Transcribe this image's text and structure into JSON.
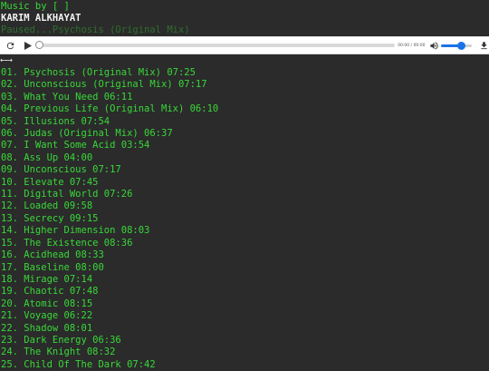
{
  "header": {
    "music_by": "Music by [ ]",
    "artist": "KARIM ALKHAYAT",
    "status": "Paused...Psychosis (Original Mix)"
  },
  "player": {
    "current_time": "00:00",
    "duration": "00:00",
    "time_separator": "/",
    "volume_level": 0.64,
    "progress": 0,
    "icons": [
      "reload-icon",
      "play-icon",
      "volume-icon",
      "download-icon"
    ]
  },
  "arrows": "⟵⟶",
  "tracks": [
    "01. Psychosis (Original Mix) 07:25",
    "02. Unconscious (Original Mix) 07:17",
    "03. What You Need 06:11",
    "04. Previous Life (Original Mix) 06:10",
    "05. Illusions 07:54",
    "06. Judas (Original Mix) 06:37",
    "07. I Want Some Acid 03:54",
    "08. Ass Up 04:00",
    "09. Unconscious 07:17",
    "10. Elevate 07:45",
    "11. Digital World 07:26",
    "12. Loaded 09:58",
    "13. Secrecy 09:15",
    "14. Higher Dimension 08:03",
    "15. The Existence 08:36",
    "16. Acidhead 08:33",
    "17. Baseline 08:00",
    "18. Mirage 07:14",
    "19. Chaotic 07:48",
    "20. Atomic 08:15",
    "21. Voyage 06:22",
    "22. Shadow 08:01",
    "23. Dark Energy 06:36",
    "24. The Knight 08:32",
    "25. Child Of The Dark 07:42"
  ],
  "colors": {
    "background": "#2b2b2b",
    "track_text": "#38d838",
    "status_text": "#2f6f2f",
    "volume_accent": "#1a73e8"
  }
}
